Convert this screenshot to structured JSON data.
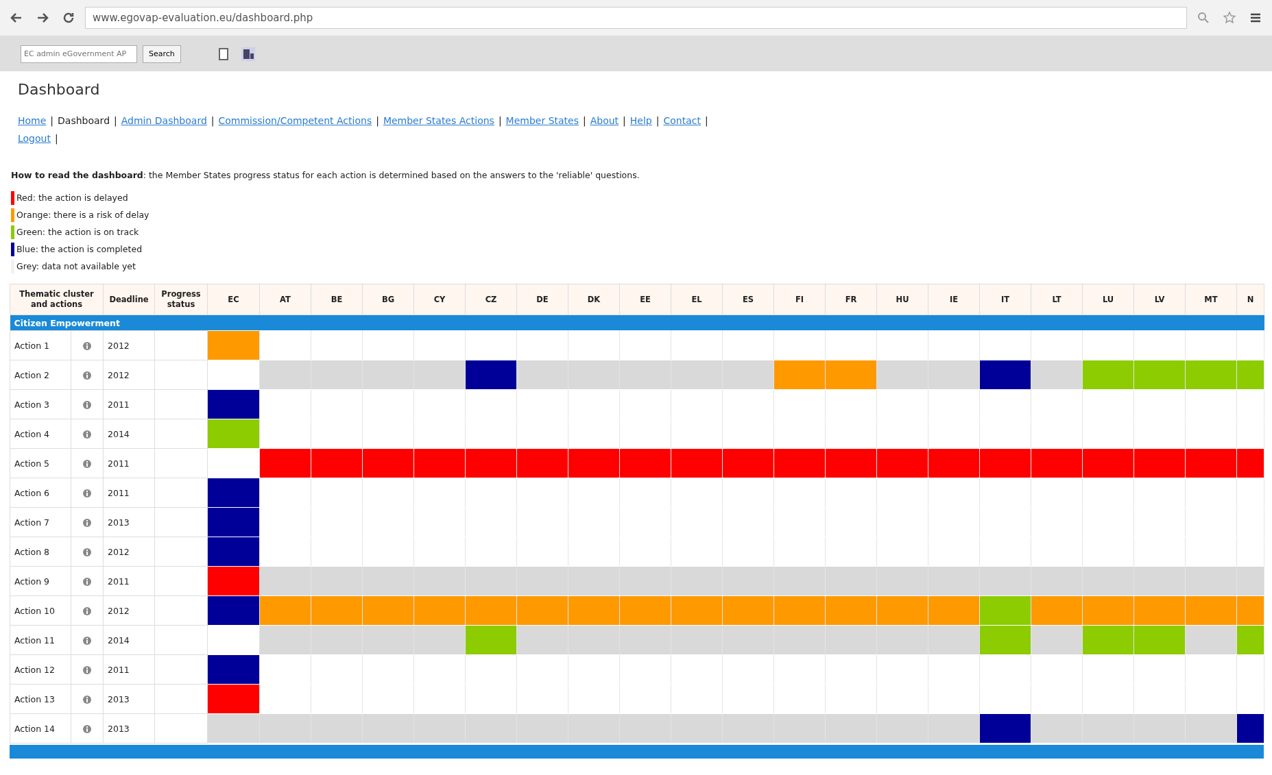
{
  "browser": {
    "url": "www.egovap-evaluation.eu/dashboard.php",
    "search_placeholder": "EC admin eGovernment AP",
    "search_button": "Search"
  },
  "page": {
    "title": "Dashboard",
    "separator": "|",
    "nav": [
      {
        "label": "Home",
        "link": true
      },
      {
        "label": "Dashboard",
        "link": false
      },
      {
        "label": "Admin Dashboard",
        "link": true
      },
      {
        "label": "Commission/Competent Actions",
        "link": true
      },
      {
        "label": "Member States Actions",
        "link": true
      },
      {
        "label": "Member States",
        "link": true
      },
      {
        "label": "About",
        "link": true
      },
      {
        "label": "Help",
        "link": true
      },
      {
        "label": "Contact",
        "link": true
      },
      {
        "label": "Logout",
        "link": true
      }
    ],
    "intro": "**How to read the dashboard**: the Member States progress status for each action is determined based on the answers to the 'reliable' questions.",
    "legend": [
      {
        "text": "Red: the action is delayed",
        "color": "#ff0000"
      },
      {
        "text": "Orange: there is a risk of delay",
        "color": "#ff9900"
      },
      {
        "text": "Green: the action is on track",
        "color": "#8ccc00"
      },
      {
        "text": "Blue: the action is completed",
        "color": "#000099"
      },
      {
        "text": "Grey: data not available yet",
        "color": "#f2f2f2"
      }
    ]
  },
  "table": {
    "columns": [
      "Thematic cluster and actions",
      "Deadline",
      "Progress status"
    ],
    "countries": [
      "EC",
      "AT",
      "BE",
      "BG",
      "CY",
      "CZ",
      "DE",
      "DK",
      "EE",
      "EL",
      "ES",
      "FI",
      "FR",
      "HU",
      "IE",
      "IT",
      "LT",
      "LU",
      "LV",
      "MT",
      "N"
    ],
    "section": "Citizen Empowerment",
    "rows": [
      {
        "action": "Action 1",
        "deadline": "2012",
        "cells": [
          {
            "color": "#ff9900"
          },
          {
            "color": "#ffffff"
          },
          {
            "color": "#ffffff"
          },
          {
            "color": "#ffffff"
          },
          {
            "color": "#ffffff"
          },
          {
            "color": "#ffffff"
          },
          {
            "color": "#ffffff"
          },
          {
            "color": "#ffffff"
          },
          {
            "color": "#ffffff"
          },
          {
            "color": "#ffffff"
          },
          {
            "color": "#ffffff"
          },
          {
            "color": "#ffffff"
          },
          {
            "color": "#ffffff"
          },
          {
            "color": "#ffffff"
          },
          {
            "color": "#ffffff"
          },
          {
            "color": "#ffffff"
          },
          {
            "color": "#ffffff"
          },
          {
            "color": "#ffffff"
          },
          {
            "color": "#ffffff"
          },
          {
            "color": "#ffffff"
          },
          {
            "color": "#ffffff"
          }
        ]
      },
      {
        "action": "Action 2",
        "deadline": "2012",
        "cells": [
          {
            "color": "#ffffff"
          },
          {
            "color": "#d9d9d9"
          },
          {
            "color": "#d9d9d9"
          },
          {
            "color": "#d9d9d9"
          },
          {
            "color": "#d9d9d9"
          },
          {
            "color": "#000099"
          },
          {
            "color": "#d9d9d9"
          },
          {
            "color": "#d9d9d9"
          },
          {
            "color": "#d9d9d9"
          },
          {
            "color": "#d9d9d9"
          },
          {
            "color": "#d9d9d9"
          },
          {
            "color": "#ff9900"
          },
          {
            "color": "#ff9900"
          },
          {
            "color": "#d9d9d9"
          },
          {
            "color": "#d9d9d9"
          },
          {
            "color": "#000099"
          },
          {
            "color": "#d9d9d9"
          },
          {
            "color": "#8ccc00"
          },
          {
            "color": "#8ccc00"
          },
          {
            "color": "#8ccc00"
          },
          {
            "color": "#8ccc00"
          }
        ]
      },
      {
        "action": "Action 3",
        "deadline": "2011",
        "cells": [
          {
            "color": "#000099"
          },
          {
            "color": "#ffffff"
          },
          {
            "color": "#ffffff"
          },
          {
            "color": "#ffffff"
          },
          {
            "color": "#ffffff"
          },
          {
            "color": "#ffffff"
          },
          {
            "color": "#ffffff"
          },
          {
            "color": "#ffffff"
          },
          {
            "color": "#ffffff"
          },
          {
            "color": "#ffffff"
          },
          {
            "color": "#ffffff"
          },
          {
            "color": "#ffffff"
          },
          {
            "color": "#ffffff"
          },
          {
            "color": "#ffffff"
          },
          {
            "color": "#ffffff"
          },
          {
            "color": "#ffffff"
          },
          {
            "color": "#ffffff"
          },
          {
            "color": "#ffffff"
          },
          {
            "color": "#ffffff"
          },
          {
            "color": "#ffffff"
          },
          {
            "color": "#ffffff"
          }
        ]
      },
      {
        "action": "Action 4",
        "deadline": "2014",
        "cells": [
          {
            "color": "#8ccc00"
          },
          {
            "color": "#ffffff"
          },
          {
            "color": "#ffffff"
          },
          {
            "color": "#ffffff"
          },
          {
            "color": "#ffffff"
          },
          {
            "color": "#ffffff"
          },
          {
            "color": "#ffffff"
          },
          {
            "color": "#ffffff"
          },
          {
            "color": "#ffffff"
          },
          {
            "color": "#ffffff"
          },
          {
            "color": "#ffffff"
          },
          {
            "color": "#ffffff"
          },
          {
            "color": "#ffffff"
          },
          {
            "color": "#ffffff"
          },
          {
            "color": "#ffffff"
          },
          {
            "color": "#ffffff"
          },
          {
            "color": "#ffffff"
          },
          {
            "color": "#ffffff"
          },
          {
            "color": "#ffffff"
          },
          {
            "color": "#ffffff"
          },
          {
            "color": "#ffffff"
          }
        ]
      },
      {
        "action": "Action 5",
        "deadline": "2011",
        "cells": [
          {
            "color": "#ffffff"
          },
          {
            "color": "#ff0000"
          },
          {
            "color": "#ff0000"
          },
          {
            "color": "#ff0000"
          },
          {
            "color": "#ff0000"
          },
          {
            "color": "#ff0000"
          },
          {
            "color": "#ff0000"
          },
          {
            "color": "#ff0000"
          },
          {
            "color": "#ff0000"
          },
          {
            "color": "#ff0000"
          },
          {
            "color": "#ff0000"
          },
          {
            "color": "#ff0000"
          },
          {
            "color": "#ff0000"
          },
          {
            "color": "#ff0000"
          },
          {
            "color": "#ff0000"
          },
          {
            "color": "#ff0000"
          },
          {
            "color": "#ff0000"
          },
          {
            "color": "#ff0000"
          },
          {
            "color": "#ff0000"
          },
          {
            "color": "#ff0000"
          },
          {
            "color": "#ff0000"
          }
        ]
      },
      {
        "action": "Action 6",
        "deadline": "2011",
        "cells": [
          {
            "color": "#000099"
          },
          {
            "color": "#ffffff"
          },
          {
            "color": "#ffffff"
          },
          {
            "color": "#ffffff"
          },
          {
            "color": "#ffffff"
          },
          {
            "color": "#ffffff"
          },
          {
            "color": "#ffffff"
          },
          {
            "color": "#ffffff"
          },
          {
            "color": "#ffffff"
          },
          {
            "color": "#ffffff"
          },
          {
            "color": "#ffffff"
          },
          {
            "color": "#ffffff"
          },
          {
            "color": "#ffffff"
          },
          {
            "color": "#ffffff"
          },
          {
            "color": "#ffffff"
          },
          {
            "color": "#ffffff"
          },
          {
            "color": "#ffffff"
          },
          {
            "color": "#ffffff"
          },
          {
            "color": "#ffffff"
          },
          {
            "color": "#ffffff"
          },
          {
            "color": "#ffffff"
          }
        ]
      },
      {
        "action": "Action 7",
        "deadline": "2013",
        "cells": [
          {
            "color": "#000099"
          },
          {
            "color": "#ffffff"
          },
          {
            "color": "#ffffff"
          },
          {
            "color": "#ffffff"
          },
          {
            "color": "#ffffff"
          },
          {
            "color": "#ffffff"
          },
          {
            "color": "#ffffff"
          },
          {
            "color": "#ffffff"
          },
          {
            "color": "#ffffff"
          },
          {
            "color": "#ffffff"
          },
          {
            "color": "#ffffff"
          },
          {
            "color": "#ffffff"
          },
          {
            "color": "#ffffff"
          },
          {
            "color": "#ffffff"
          },
          {
            "color": "#ffffff"
          },
          {
            "color": "#ffffff"
          },
          {
            "color": "#ffffff"
          },
          {
            "color": "#ffffff"
          },
          {
            "color": "#ffffff"
          },
          {
            "color": "#ffffff"
          },
          {
            "color": "#ffffff"
          }
        ]
      },
      {
        "action": "Action 8",
        "deadline": "2012",
        "cells": [
          {
            "color": "#000099"
          },
          {
            "color": "#ffffff"
          },
          {
            "color": "#ffffff"
          },
          {
            "color": "#ffffff"
          },
          {
            "color": "#ffffff"
          },
          {
            "color": "#ffffff"
          },
          {
            "color": "#ffffff"
          },
          {
            "color": "#ffffff"
          },
          {
            "color": "#ffffff"
          },
          {
            "color": "#ffffff"
          },
          {
            "color": "#ffffff"
          },
          {
            "color": "#ffffff"
          },
          {
            "color": "#ffffff"
          },
          {
            "color": "#ffffff"
          },
          {
            "color": "#ffffff"
          },
          {
            "color": "#ffffff"
          },
          {
            "color": "#ffffff"
          },
          {
            "color": "#ffffff"
          },
          {
            "color": "#ffffff"
          },
          {
            "color": "#ffffff"
          },
          {
            "color": "#ffffff"
          }
        ]
      },
      {
        "action": "Action 9",
        "deadline": "2011",
        "cells": [
          {
            "color": "#ff0000"
          },
          {
            "color": "#d9d9d9"
          },
          {
            "color": "#d9d9d9"
          },
          {
            "color": "#d9d9d9"
          },
          {
            "color": "#d9d9d9"
          },
          {
            "color": "#d9d9d9"
          },
          {
            "color": "#d9d9d9"
          },
          {
            "color": "#d9d9d9"
          },
          {
            "color": "#d9d9d9"
          },
          {
            "color": "#d9d9d9"
          },
          {
            "color": "#d9d9d9"
          },
          {
            "color": "#d9d9d9"
          },
          {
            "color": "#d9d9d9"
          },
          {
            "color": "#d9d9d9"
          },
          {
            "color": "#d9d9d9"
          },
          {
            "color": "#d9d9d9"
          },
          {
            "color": "#d9d9d9"
          },
          {
            "color": "#d9d9d9"
          },
          {
            "color": "#d9d9d9"
          },
          {
            "color": "#d9d9d9"
          },
          {
            "color": "#d9d9d9"
          }
        ]
      },
      {
        "action": "Action 10",
        "deadline": "2012",
        "cells": [
          {
            "color": "#000099"
          },
          {
            "color": "#ff9900"
          },
          {
            "color": "#ff9900"
          },
          {
            "color": "#ff9900"
          },
          {
            "color": "#ff9900"
          },
          {
            "color": "#ff9900"
          },
          {
            "color": "#ff9900"
          },
          {
            "color": "#ff9900"
          },
          {
            "color": "#ff9900"
          },
          {
            "color": "#ff9900"
          },
          {
            "color": "#ff9900"
          },
          {
            "color": "#ff9900"
          },
          {
            "color": "#ff9900"
          },
          {
            "color": "#ff9900"
          },
          {
            "color": "#ff9900"
          },
          {
            "color": "#8ccc00"
          },
          {
            "color": "#ff9900"
          },
          {
            "color": "#ff9900"
          },
          {
            "color": "#ff9900"
          },
          {
            "color": "#ff9900"
          },
          {
            "color": "#ff9900"
          }
        ]
      },
      {
        "action": "Action 11",
        "deadline": "2014",
        "cells": [
          {
            "color": "#ffffff"
          },
          {
            "color": "#d9d9d9"
          },
          {
            "color": "#d9d9d9"
          },
          {
            "color": "#d9d9d9"
          },
          {
            "color": "#d9d9d9"
          },
          {
            "color": "#8ccc00"
          },
          {
            "color": "#d9d9d9"
          },
          {
            "color": "#d9d9d9"
          },
          {
            "color": "#d9d9d9"
          },
          {
            "color": "#d9d9d9"
          },
          {
            "color": "#d9d9d9"
          },
          {
            "color": "#d9d9d9"
          },
          {
            "color": "#d9d9d9"
          },
          {
            "color": "#d9d9d9"
          },
          {
            "color": "#d9d9d9"
          },
          {
            "color": "#8ccc00"
          },
          {
            "color": "#d9d9d9"
          },
          {
            "color": "#8ccc00"
          },
          {
            "color": "#8ccc00"
          },
          {
            "color": "#d9d9d9"
          },
          {
            "color": "#8ccc00"
          }
        ]
      },
      {
        "action": "Action 12",
        "deadline": "2011",
        "cells": [
          {
            "color": "#000099"
          },
          {
            "color": "#ffffff"
          },
          {
            "color": "#ffffff"
          },
          {
            "color": "#ffffff"
          },
          {
            "color": "#ffffff"
          },
          {
            "color": "#ffffff"
          },
          {
            "color": "#ffffff"
          },
          {
            "color": "#ffffff"
          },
          {
            "color": "#ffffff"
          },
          {
            "color": "#ffffff"
          },
          {
            "color": "#ffffff"
          },
          {
            "color": "#ffffff"
          },
          {
            "color": "#ffffff"
          },
          {
            "color": "#ffffff"
          },
          {
            "color": "#ffffff"
          },
          {
            "color": "#ffffff"
          },
          {
            "color": "#ffffff"
          },
          {
            "color": "#ffffff"
          },
          {
            "color": "#ffffff"
          },
          {
            "color": "#ffffff"
          },
          {
            "color": "#ffffff"
          }
        ]
      },
      {
        "action": "Action 13",
        "deadline": "2013",
        "cells": [
          {
            "color": "#ff0000"
          },
          {
            "color": "#ffffff"
          },
          {
            "color": "#ffffff"
          },
          {
            "color": "#ffffff"
          },
          {
            "color": "#ffffff"
          },
          {
            "color": "#ffffff"
          },
          {
            "color": "#ffffff"
          },
          {
            "color": "#ffffff"
          },
          {
            "color": "#ffffff"
          },
          {
            "color": "#ffffff"
          },
          {
            "color": "#ffffff"
          },
          {
            "color": "#ffffff"
          },
          {
            "color": "#ffffff"
          },
          {
            "color": "#ffffff"
          },
          {
            "color": "#ffffff"
          },
          {
            "color": "#ffffff"
          },
          {
            "color": "#ffffff"
          },
          {
            "color": "#ffffff"
          },
          {
            "color": "#ffffff"
          },
          {
            "color": "#ffffff"
          },
          {
            "color": "#ffffff"
          }
        ]
      },
      {
        "action": "Action 14",
        "deadline": "2013",
        "cells": [
          {
            "color": "#d9d9d9"
          },
          {
            "color": "#d9d9d9"
          },
          {
            "color": "#d9d9d9"
          },
          {
            "color": "#d9d9d9"
          },
          {
            "color": "#d9d9d9"
          },
          {
            "color": "#d9d9d9"
          },
          {
            "color": "#d9d9d9"
          },
          {
            "color": "#d9d9d9"
          },
          {
            "color": "#d9d9d9"
          },
          {
            "color": "#d9d9d9"
          },
          {
            "color": "#d9d9d9"
          },
          {
            "color": "#d9d9d9"
          },
          {
            "color": "#d9d9d9"
          },
          {
            "color": "#d9d9d9"
          },
          {
            "color": "#d9d9d9"
          },
          {
            "color": "#000099"
          },
          {
            "color": "#d9d9d9"
          },
          {
            "color": "#d9d9d9"
          },
          {
            "color": "#d9d9d9"
          },
          {
            "color": "#d9d9d9"
          },
          {
            "color": "#000099"
          }
        ]
      }
    ]
  }
}
